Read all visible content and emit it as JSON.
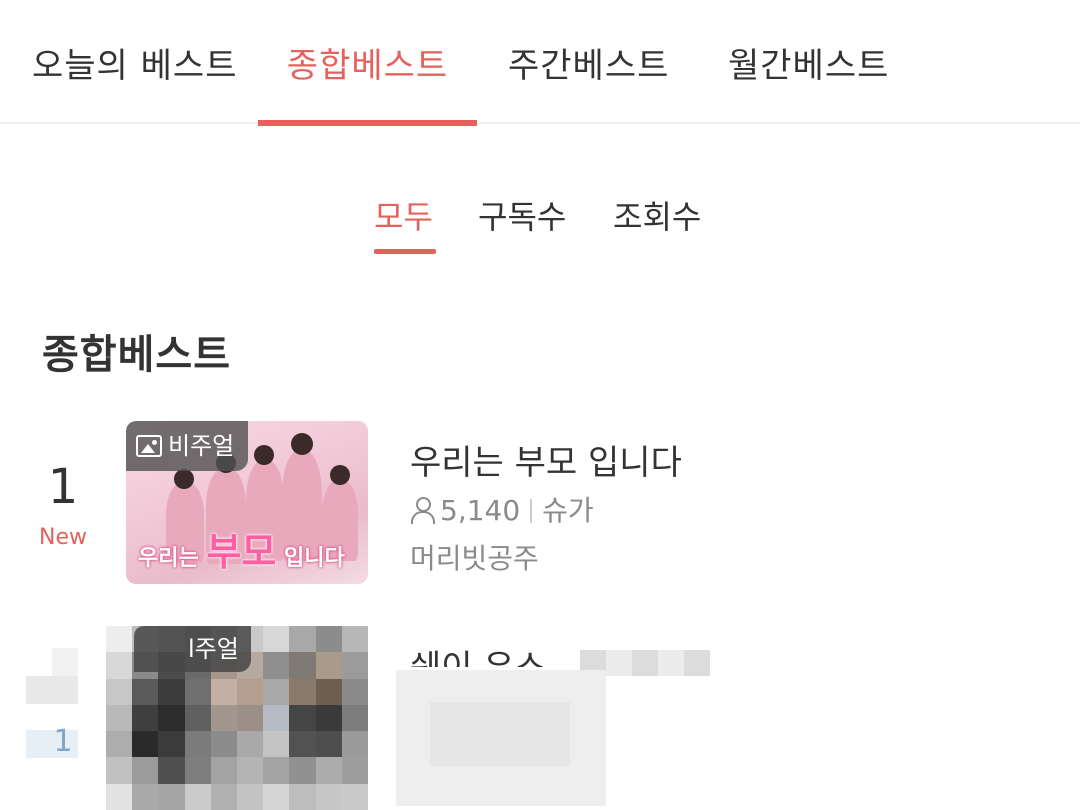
{
  "top_tabs": [
    {
      "label": "오늘의 베스트",
      "active": false
    },
    {
      "label": "종합베스트",
      "active": true
    },
    {
      "label": "주간베스트",
      "active": false
    },
    {
      "label": "월간베스트",
      "active": false
    }
  ],
  "sub_tabs": [
    {
      "label": "모두",
      "active": true
    },
    {
      "label": "구독수",
      "active": false
    },
    {
      "label": "조회수",
      "active": false
    }
  ],
  "section_title": "종합베스트",
  "items": [
    {
      "rank": "1",
      "rank_change": "New",
      "badge": "비주얼",
      "badge_icon": "image-icon",
      "thumbnail_text": {
        "pre": "우리는",
        "big": "부모",
        "post": "입니다"
      },
      "title": "우리는 부모 입니다",
      "subscribers": "5,140",
      "genre": "슈가",
      "author": "머리빗공주"
    },
    {
      "rank": "1",
      "badge": "l주얼",
      "title": "쉐이 우스"
    }
  ],
  "colors": {
    "accent": "#e5615c",
    "text": "#333333",
    "meta": "#8a8a8a"
  }
}
